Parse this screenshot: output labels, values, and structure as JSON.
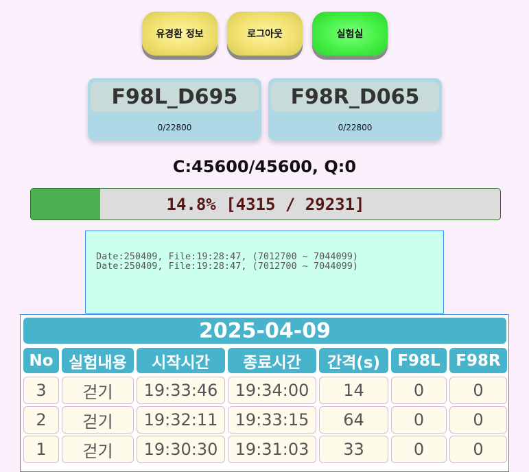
{
  "nav": {
    "info_label": "유경환 정보",
    "logout_label": "로그아웃",
    "lab_label": "실험실"
  },
  "devices": [
    {
      "name": "F98L_D695",
      "count": "0/22800"
    },
    {
      "name": "F98R_D065",
      "count": "0/22800"
    }
  ],
  "status": {
    "cq": "C:45600/45600, Q:0"
  },
  "progress": {
    "fraction": 0.148,
    "text": "14.8% [4315 / 29231]"
  },
  "log": {
    "lines": [
      "Date:250409, File:19:28:47, (7012700 ~ 7044099)",
      "Date:250409, File:19:28:47, (7012700 ~ 7044099)"
    ]
  },
  "table": {
    "date": "2025-04-09",
    "headers": [
      "No",
      "실험내용",
      "시작시간",
      "종료시간",
      "간격(s)",
      "F98L",
      "F98R"
    ],
    "rows": [
      [
        "3",
        "걷기",
        "19:33:46",
        "19:34:00",
        "14",
        "0",
        "0"
      ],
      [
        "2",
        "걷기",
        "19:32:11",
        "19:33:15",
        "64",
        "0",
        "0"
      ],
      [
        "1",
        "걷기",
        "19:30:30",
        "19:31:03",
        "33",
        "0",
        "0"
      ]
    ]
  },
  "colors": {
    "background": "#fdf0fd",
    "yellow_button": "#f1e171",
    "green_button": "#44f044",
    "device_card": "#aed8e6",
    "progress_fill": "#4caf50",
    "table_header": "#48b4cc"
  }
}
